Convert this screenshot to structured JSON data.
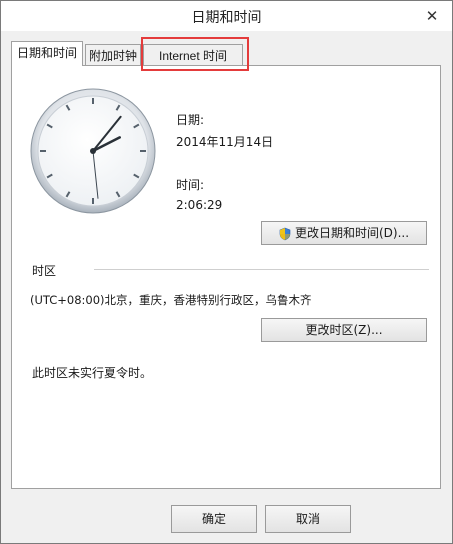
{
  "window": {
    "title": "日期和时间",
    "close_icon": "✕"
  },
  "tabs": [
    {
      "label": "日期和时间",
      "active": true
    },
    {
      "label": "附加时钟",
      "active": false
    },
    {
      "label": "Internet 时间",
      "active": false
    }
  ],
  "clock": {
    "hour": 2,
    "minute": 6,
    "second": 29
  },
  "date": {
    "label": "日期:",
    "value": "2014年11月14日"
  },
  "time": {
    "label": "时间:",
    "value": "2:06:29"
  },
  "buttons": {
    "change_datetime": "更改日期和时间(D)...",
    "change_timezone": "更改时区(Z)...",
    "ok": "确定",
    "cancel": "取消"
  },
  "timezone": {
    "section_label": "时区",
    "value": "(UTC+08:00)北京，重庆，香港特别行政区，乌鲁木齐",
    "dst_note": "此时区未实行夏令时。"
  },
  "annotation": {
    "color": "#e43b3b"
  }
}
